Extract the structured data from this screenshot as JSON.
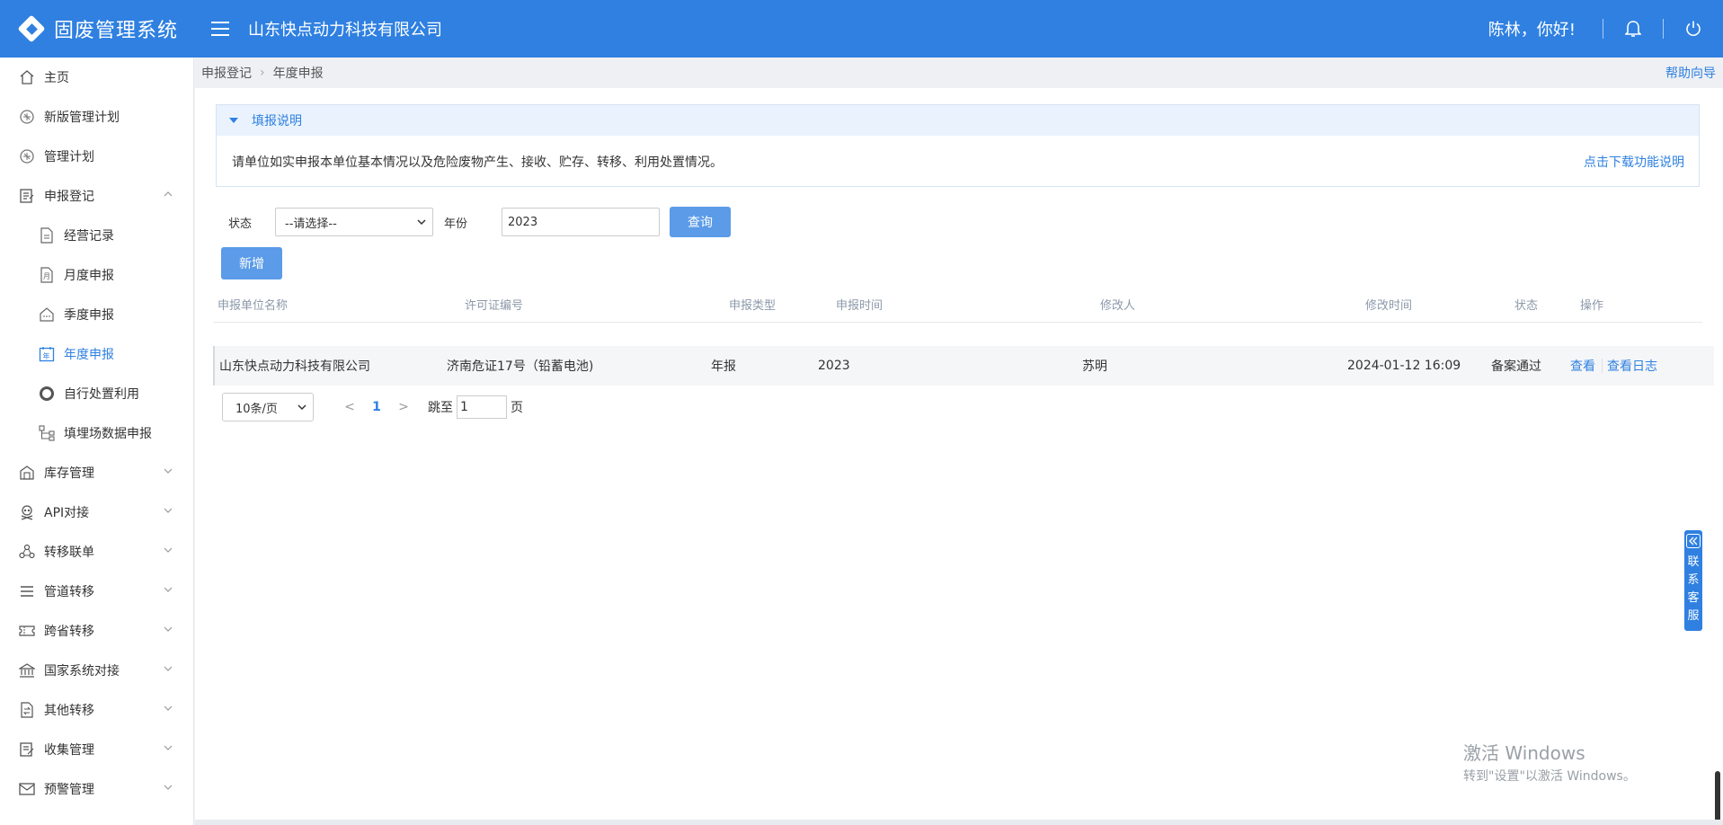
{
  "header": {
    "app_title": "固废管理系统",
    "company": "山东快点动力科技有限公司",
    "greeting": "陈林，你好!"
  },
  "sidebar": {
    "items": [
      {
        "label": "主页",
        "icon": "home-icon"
      },
      {
        "label": "新版管理计划",
        "icon": "plan-icon"
      },
      {
        "label": "管理计划",
        "icon": "plan-icon"
      },
      {
        "label": "申报登记",
        "icon": "form-icon",
        "expanded": true
      },
      {
        "label": "经营记录",
        "icon": "document-icon"
      },
      {
        "label": "月度申报",
        "icon": "month-icon"
      },
      {
        "label": "季度申报",
        "icon": "building-icon"
      },
      {
        "label": "年度申报",
        "icon": "year-icon",
        "active": true
      },
      {
        "label": "自行处置利用",
        "icon": "ring-icon"
      },
      {
        "label": "填埋场数据申报",
        "icon": "flow-icon"
      },
      {
        "label": "库存管理",
        "icon": "warehouse-icon"
      },
      {
        "label": "API对接",
        "icon": "skull-icon"
      },
      {
        "label": "转移联单",
        "icon": "share-icon"
      },
      {
        "label": "管道转移",
        "icon": "list-icon"
      },
      {
        "label": "跨省转移",
        "icon": "ticket-icon"
      },
      {
        "label": "国家系统对接",
        "icon": "bank-icon"
      },
      {
        "label": "其他转移",
        "icon": "transfer-doc-icon"
      },
      {
        "label": "收集管理",
        "icon": "edit-icon"
      },
      {
        "label": "预警管理",
        "icon": "mail-icon"
      }
    ]
  },
  "breadcrumb": {
    "parent": "申报登记",
    "current": "年度申报",
    "help": "帮助向导"
  },
  "notice": {
    "title": "填报说明",
    "text": "请单位如实申报本单位基本情况以及危险废物产生、接收、贮存、转移、利用处置情况。",
    "download": "点击下载功能说明"
  },
  "filter": {
    "status_label": "状态",
    "status_value": "--请选择--",
    "year_label": "年份",
    "year_value": "2023",
    "query_button": "查询",
    "add_button": "新增"
  },
  "table": {
    "columns": [
      "申报单位名称",
      "许可证编号",
      "申报类型",
      "申报时间",
      "修改人",
      "修改时间",
      "状态",
      "操作"
    ],
    "rows": [
      {
        "unit": "山东快点动力科技有限公司",
        "license": "济南危证17号（铅蓄电池)",
        "type": "年报",
        "time": "2023",
        "modifier": "苏明",
        "modified": "2024-01-12 16:09",
        "status": "备案通过",
        "view": "查看",
        "log": "查看日志"
      }
    ]
  },
  "pager": {
    "page_size": "10条/页",
    "prev": "<",
    "current": "1",
    "next": ">",
    "jump_label": "跳至",
    "jump_value": "1",
    "page_suffix": "页"
  },
  "kefu": {
    "label": "联系客服"
  },
  "watermark": {
    "line1": "激活 Windows",
    "line2": "转到\"设置\"以激活 Windows。"
  },
  "colors": {
    "primary": "#2f80e1",
    "button": "#5b9be8"
  }
}
